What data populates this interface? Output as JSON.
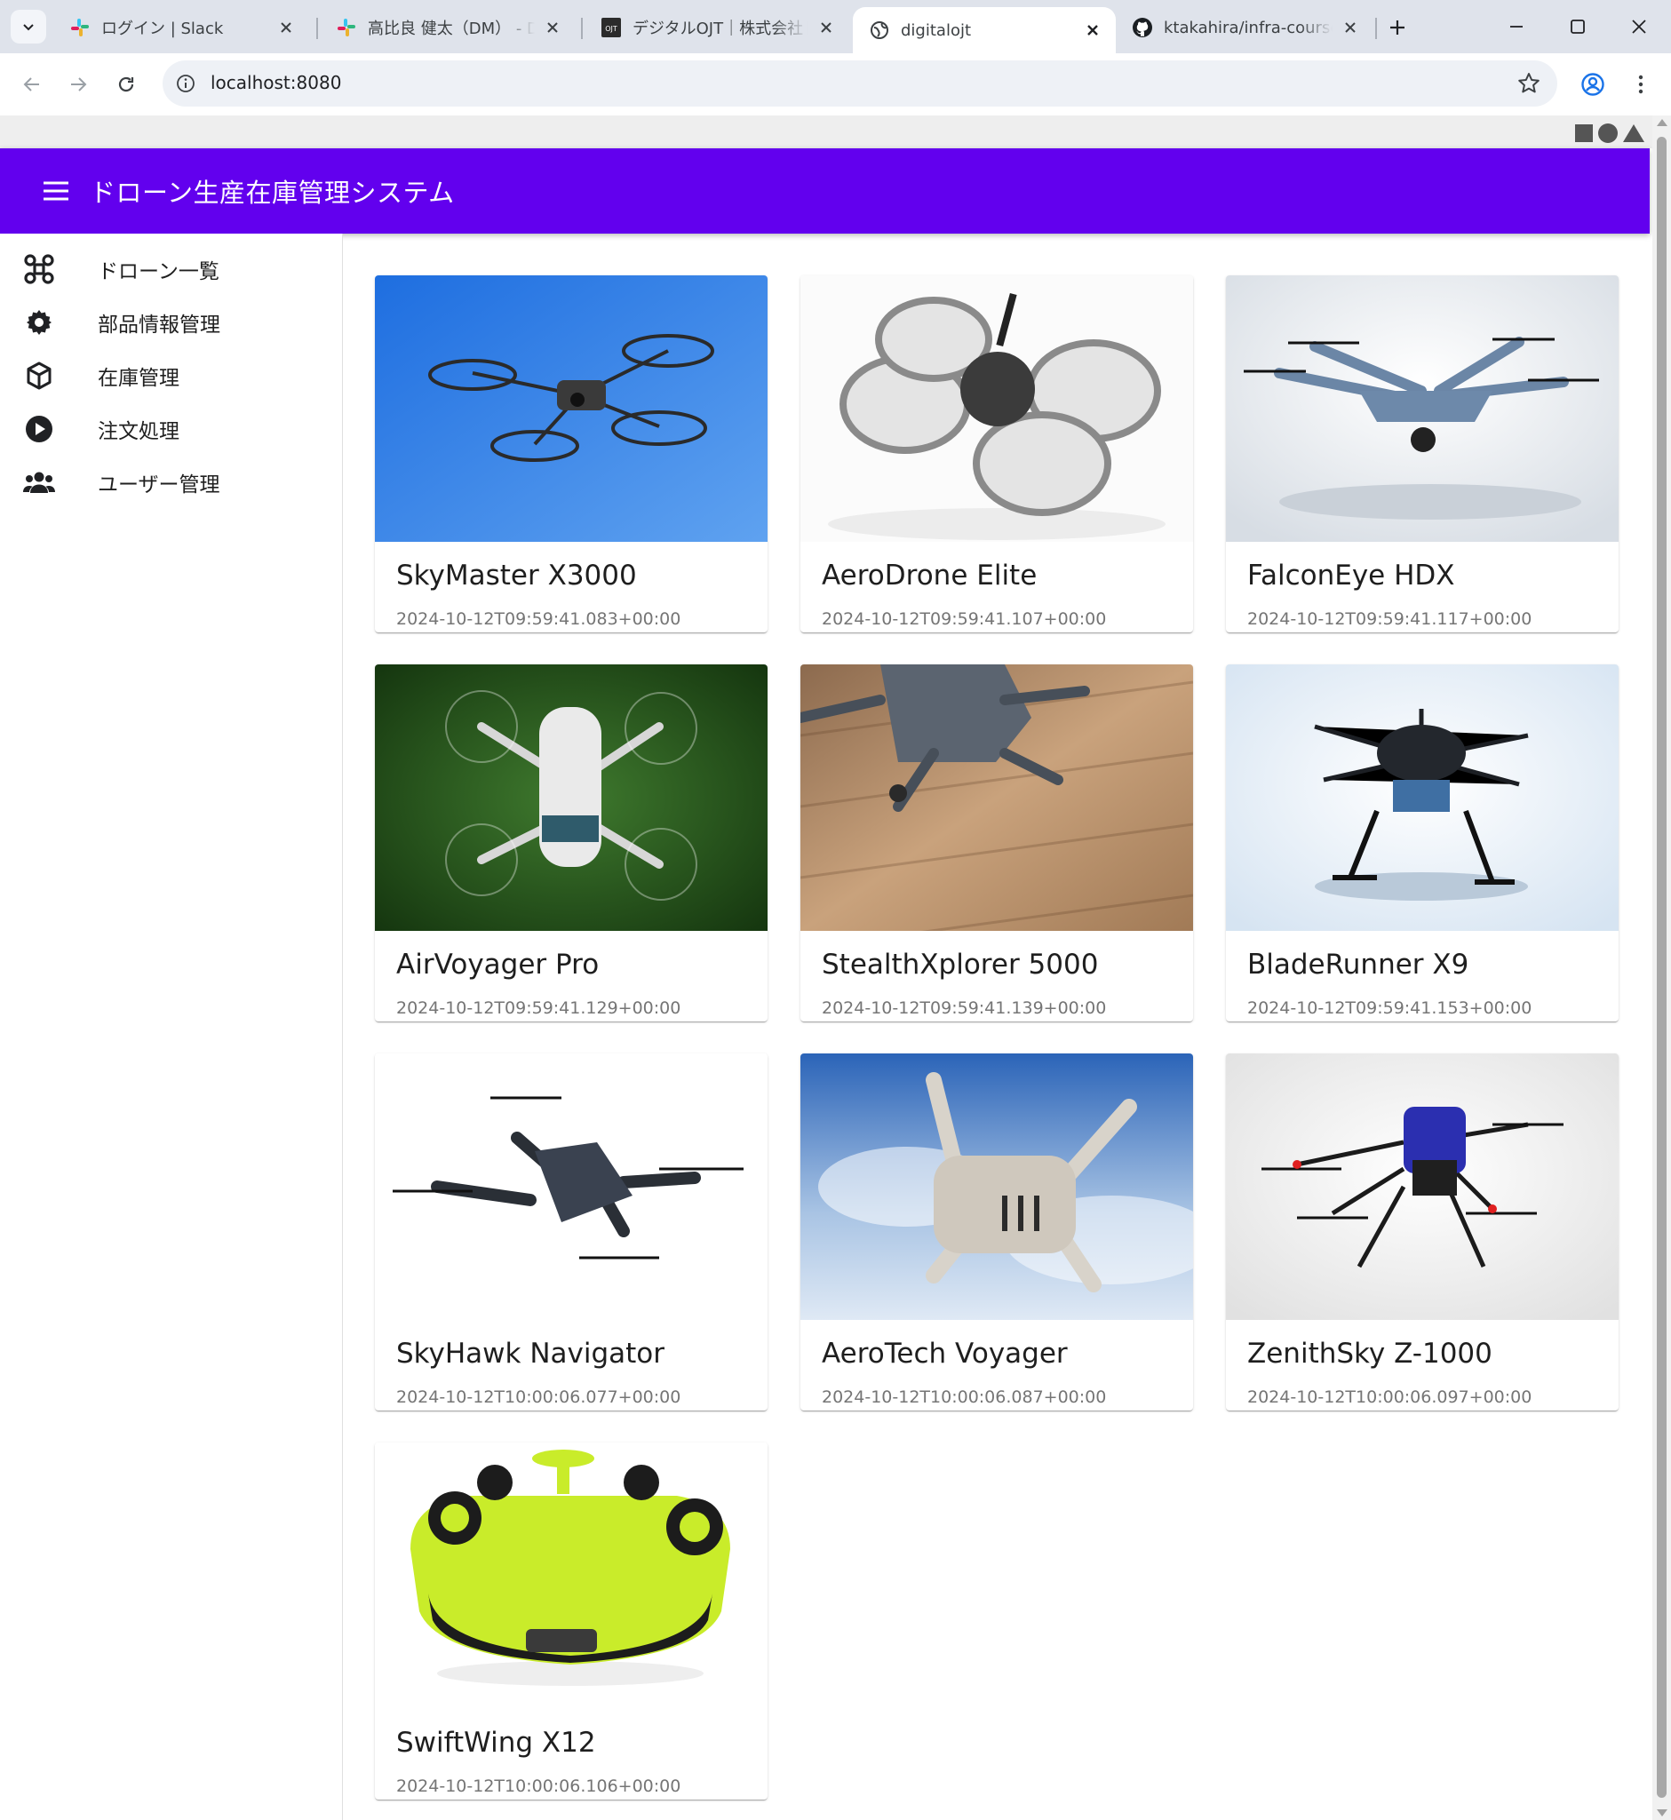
{
  "browser": {
    "tabs": [
      {
        "label": "ログイン | Slack",
        "favicon": "slack-icon",
        "active": false
      },
      {
        "label": "高比良 健太（DM） - Digital OJT - Slack",
        "favicon": "slack-icon",
        "active": false
      },
      {
        "label": "デジタルOJT｜株式会社ドットモーション",
        "favicon": "digitalojt-icon",
        "active": false
      },
      {
        "label": "digitalojt",
        "favicon": "globe-icon",
        "active": true
      },
      {
        "label": "ktakahira/infra-course-demo",
        "favicon": "github-icon",
        "active": false
      }
    ],
    "url": "localhost:8080"
  },
  "app": {
    "title": "ドローン生産在庫管理システム",
    "colors": {
      "appbar": "#6200ee"
    }
  },
  "nav": {
    "items": [
      {
        "label": "ドローン一覧",
        "icon": "drone-icon"
      },
      {
        "label": "部品情報管理",
        "icon": "gear-icon"
      },
      {
        "label": "在庫管理",
        "icon": "package-icon"
      },
      {
        "label": "注文処理",
        "icon": "play-circle-icon"
      },
      {
        "label": "ユーザー管理",
        "icon": "users-icon"
      }
    ]
  },
  "drones": [
    {
      "name": "SkyMaster X3000",
      "created": "2024-10-12T09:59:41.083+00:00"
    },
    {
      "name": "AeroDrone Elite",
      "created": "2024-10-12T09:59:41.107+00:00"
    },
    {
      "name": "FalconEye HDX",
      "created": "2024-10-12T09:59:41.117+00:00"
    },
    {
      "name": "AirVoyager Pro",
      "created": "2024-10-12T09:59:41.129+00:00"
    },
    {
      "name": "StealthXplorer 5000",
      "created": "2024-10-12T09:59:41.139+00:00"
    },
    {
      "name": "BladeRunner X9",
      "created": "2024-10-12T09:59:41.153+00:00"
    },
    {
      "name": "SkyHawk Navigator",
      "created": "2024-10-12T10:00:06.077+00:00"
    },
    {
      "name": "AeroTech Voyager",
      "created": "2024-10-12T10:00:06.087+00:00"
    },
    {
      "name": "ZenithSky Z-1000",
      "created": "2024-10-12T10:00:06.097+00:00"
    },
    {
      "name": "SwiftWing X12",
      "created": "2024-10-12T10:00:06.106+00:00"
    }
  ]
}
